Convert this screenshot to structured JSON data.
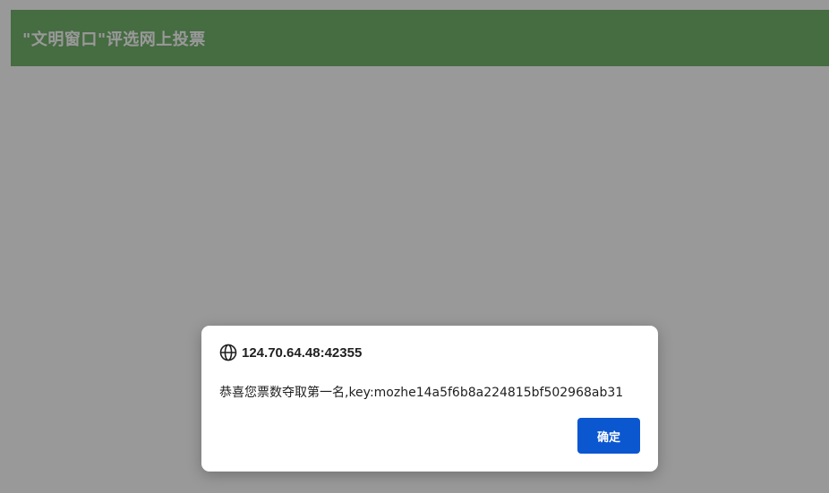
{
  "page": {
    "header_title": "\"文明窗口\"评选网上投票"
  },
  "dialog": {
    "origin": "124.70.64.48:42355",
    "origin_icon": "globe-icon",
    "message": "恭喜您票数夺取第一名,key:mozhe14a5f6b8a224815bf502968ab31",
    "ok_label": "确定"
  },
  "colors": {
    "header_bg": "#75b56e",
    "button_bg": "#0b57d0",
    "overlay": "rgba(0,0,0,0.40)"
  }
}
